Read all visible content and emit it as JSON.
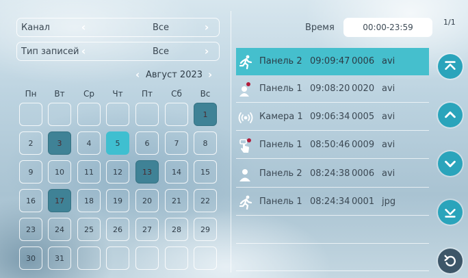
{
  "filters": {
    "channel": {
      "label": "Канал",
      "value": "Все"
    },
    "record_type": {
      "label": "Тип записей",
      "value": "Все"
    }
  },
  "calendar": {
    "month_label": "Август 2023",
    "weekdays": [
      "Пн",
      "Вт",
      "Ср",
      "Чт",
      "Пт",
      "Сб",
      "Вс"
    ],
    "days": [
      "1",
      "2",
      "3",
      "4",
      "5",
      "6",
      "7",
      "8",
      "9",
      "10",
      "11",
      "12",
      "13",
      "14",
      "15",
      "16",
      "17",
      "18",
      "19",
      "20",
      "21",
      "22",
      "23",
      "24",
      "25",
      "26",
      "27",
      "28",
      "29",
      "30",
      "31"
    ],
    "days_with_records": [
      "1",
      "3",
      "13",
      "17"
    ],
    "today": "5"
  },
  "time_filter": {
    "label": "Время",
    "value": "00:00-23:59"
  },
  "page_indicator": "1/1",
  "records": [
    {
      "icon": "motion-icon",
      "channel": "Панель 2",
      "time": "09:09:47",
      "count": "0006",
      "ext": "avi"
    },
    {
      "icon": "call-recorded-icon",
      "channel": "Панель 1",
      "time": "09:08:20",
      "count": "0020",
      "ext": "avi"
    },
    {
      "icon": "camera-signal-icon",
      "channel": "Камера 1",
      "time": "09:06:34",
      "count": "0005",
      "ext": "avi"
    },
    {
      "icon": "touch-icon",
      "channel": "Панель 1",
      "time": "08:50:46",
      "count": "0009",
      "ext": "avi"
    },
    {
      "icon": "person-icon",
      "channel": "Панель 2",
      "time": "08:24:38",
      "count": "0006",
      "ext": "avi"
    },
    {
      "icon": "motion-icon",
      "channel": "Панель 1",
      "time": "08:24:34",
      "count": "0001",
      "ext": "jpg"
    }
  ],
  "colors": {
    "accent": "#45bfcd",
    "record_day": "#3f8296",
    "nav_button": "#2aa4bb",
    "back_button": "#3d5668",
    "alert_dot": "#b01c3a"
  }
}
